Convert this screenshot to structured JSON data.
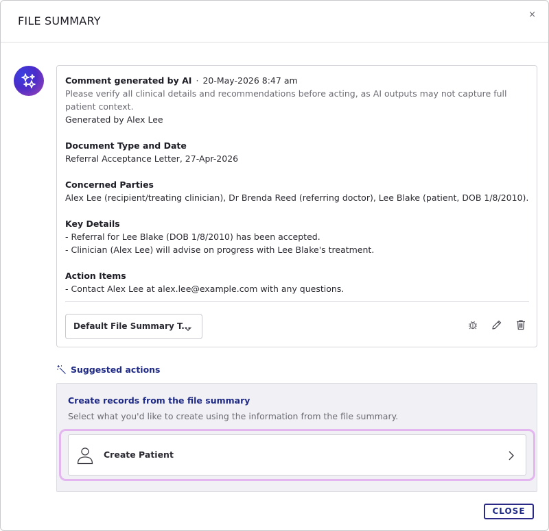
{
  "modal": {
    "title": "FILE SUMMARY",
    "close_icon": "×"
  },
  "comment": {
    "author": "Comment generated by AI",
    "separator": "·",
    "timestamp": "20-May-2026 8:47 am",
    "disclaimer": "Please verify all clinical details and recommendations before acting, as AI outputs may not capture full patient context.",
    "generated_by": "Generated by Alex Lee",
    "sections": [
      {
        "heading": "Document Type and Date",
        "lines": [
          "Referral Acceptance Letter, 27-Apr-2026"
        ]
      },
      {
        "heading": "Concerned Parties",
        "lines": [
          "Alex Lee (recipient/treating clinician), Dr Brenda Reed (referring doctor), Lee Blake (patient, DOB 1/8/2010)."
        ]
      },
      {
        "heading": "Key Details",
        "lines": [
          "- Referral for Lee Blake (DOB 1/8/2010) has been accepted.",
          "- Clinician (Alex Lee) will advise on progress with Lee Blake's treatment."
        ]
      },
      {
        "heading": "Action Items",
        "lines": [
          "- Contact Alex Lee at alex.lee@example.com with any questions."
        ]
      }
    ],
    "template_select": {
      "value": "Default File Summary T..."
    },
    "icons": [
      "bug-icon",
      "pencil-icon",
      "trash-icon"
    ]
  },
  "suggested": {
    "title": "Suggested actions",
    "panel_title": "Create records from the file summary",
    "panel_subtitle": "Select what you'd like to create using the information from the file summary.",
    "create_patient_label": "Create Patient"
  },
  "footer": {
    "close_label": "CLOSE"
  },
  "colors": {
    "accent": "#1f2a86",
    "highlight": "#e3b6ef",
    "panel_bg": "#f0f0f5"
  }
}
